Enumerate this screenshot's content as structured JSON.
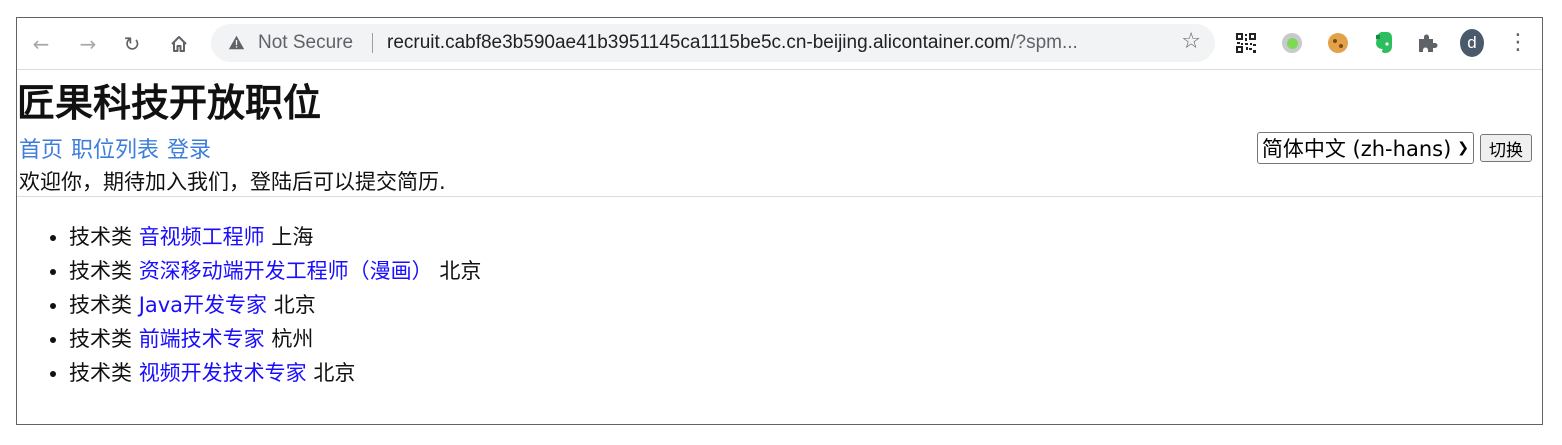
{
  "browser": {
    "security_label": "Not Secure",
    "url_host": "recruit.cabf8e3b590ae41b3951145ca1115be5c.cn-beijing.alicontainer.com",
    "url_rest": "/?spm...",
    "profile_initial": "d",
    "extensions": [
      "qr-code-icon",
      "record-icon",
      "cookie-icon",
      "evernote-icon",
      "puzzle-icon"
    ]
  },
  "page": {
    "title": "匠果科技开放职位",
    "nav": [
      "首页",
      "职位列表",
      "登录"
    ],
    "language_selected": "简体中文 (zh-hans)",
    "switch_label": "切换",
    "welcome": "欢迎你，期待加入我们，登陆后可以提交简历."
  },
  "jobs": [
    {
      "category": "技术类",
      "title": "音视频工程师",
      "city": "上海"
    },
    {
      "category": "技术类",
      "title": "资深移动端开发工程师（漫画）",
      "city": "北京"
    },
    {
      "category": "技术类",
      "title": "Java开发专家",
      "city": "北京"
    },
    {
      "category": "技术类",
      "title": "前端技术专家",
      "city": "杭州"
    },
    {
      "category": "技术类",
      "title": "视频开发技术专家",
      "city": "北京"
    }
  ],
  "colors": {
    "link": "#3d7ddc",
    "job_link": "#1a0dff",
    "text": "#111111"
  }
}
